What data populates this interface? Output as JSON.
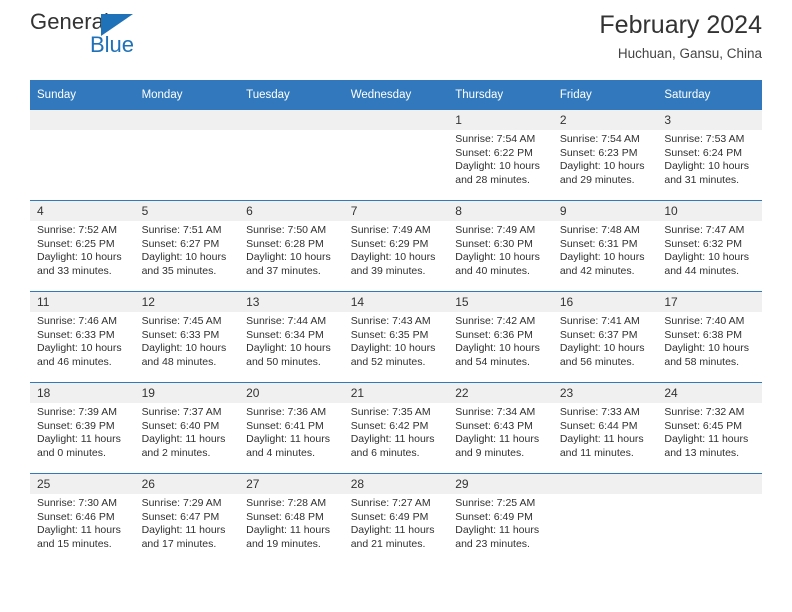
{
  "brand": {
    "word1": "General",
    "word2": "Blue",
    "accent_color": "#1f72b8"
  },
  "header": {
    "title": "February 2024",
    "subtitle": "Huchuan, Gansu, China"
  },
  "theme": {
    "header_bg": "#3179bc",
    "daynum_bg": "#f0f0f0",
    "grid_line": "#3179bc"
  },
  "weekday_headers": [
    "Sunday",
    "Monday",
    "Tuesday",
    "Wednesday",
    "Thursday",
    "Friday",
    "Saturday"
  ],
  "weeks": [
    [
      {
        "day": "",
        "sunrise": "",
        "sunset": "",
        "daylight": ""
      },
      {
        "day": "",
        "sunrise": "",
        "sunset": "",
        "daylight": ""
      },
      {
        "day": "",
        "sunrise": "",
        "sunset": "",
        "daylight": ""
      },
      {
        "day": "",
        "sunrise": "",
        "sunset": "",
        "daylight": ""
      },
      {
        "day": "1",
        "sunrise": "Sunrise: 7:54 AM",
        "sunset": "Sunset: 6:22 PM",
        "daylight": "Daylight: 10 hours and 28 minutes."
      },
      {
        "day": "2",
        "sunrise": "Sunrise: 7:54 AM",
        "sunset": "Sunset: 6:23 PM",
        "daylight": "Daylight: 10 hours and 29 minutes."
      },
      {
        "day": "3",
        "sunrise": "Sunrise: 7:53 AM",
        "sunset": "Sunset: 6:24 PM",
        "daylight": "Daylight: 10 hours and 31 minutes."
      }
    ],
    [
      {
        "day": "4",
        "sunrise": "Sunrise: 7:52 AM",
        "sunset": "Sunset: 6:25 PM",
        "daylight": "Daylight: 10 hours and 33 minutes."
      },
      {
        "day": "5",
        "sunrise": "Sunrise: 7:51 AM",
        "sunset": "Sunset: 6:27 PM",
        "daylight": "Daylight: 10 hours and 35 minutes."
      },
      {
        "day": "6",
        "sunrise": "Sunrise: 7:50 AM",
        "sunset": "Sunset: 6:28 PM",
        "daylight": "Daylight: 10 hours and 37 minutes."
      },
      {
        "day": "7",
        "sunrise": "Sunrise: 7:49 AM",
        "sunset": "Sunset: 6:29 PM",
        "daylight": "Daylight: 10 hours and 39 minutes."
      },
      {
        "day": "8",
        "sunrise": "Sunrise: 7:49 AM",
        "sunset": "Sunset: 6:30 PM",
        "daylight": "Daylight: 10 hours and 40 minutes."
      },
      {
        "day": "9",
        "sunrise": "Sunrise: 7:48 AM",
        "sunset": "Sunset: 6:31 PM",
        "daylight": "Daylight: 10 hours and 42 minutes."
      },
      {
        "day": "10",
        "sunrise": "Sunrise: 7:47 AM",
        "sunset": "Sunset: 6:32 PM",
        "daylight": "Daylight: 10 hours and 44 minutes."
      }
    ],
    [
      {
        "day": "11",
        "sunrise": "Sunrise: 7:46 AM",
        "sunset": "Sunset: 6:33 PM",
        "daylight": "Daylight: 10 hours and 46 minutes."
      },
      {
        "day": "12",
        "sunrise": "Sunrise: 7:45 AM",
        "sunset": "Sunset: 6:33 PM",
        "daylight": "Daylight: 10 hours and 48 minutes."
      },
      {
        "day": "13",
        "sunrise": "Sunrise: 7:44 AM",
        "sunset": "Sunset: 6:34 PM",
        "daylight": "Daylight: 10 hours and 50 minutes."
      },
      {
        "day": "14",
        "sunrise": "Sunrise: 7:43 AM",
        "sunset": "Sunset: 6:35 PM",
        "daylight": "Daylight: 10 hours and 52 minutes."
      },
      {
        "day": "15",
        "sunrise": "Sunrise: 7:42 AM",
        "sunset": "Sunset: 6:36 PM",
        "daylight": "Daylight: 10 hours and 54 minutes."
      },
      {
        "day": "16",
        "sunrise": "Sunrise: 7:41 AM",
        "sunset": "Sunset: 6:37 PM",
        "daylight": "Daylight: 10 hours and 56 minutes."
      },
      {
        "day": "17",
        "sunrise": "Sunrise: 7:40 AM",
        "sunset": "Sunset: 6:38 PM",
        "daylight": "Daylight: 10 hours and 58 minutes."
      }
    ],
    [
      {
        "day": "18",
        "sunrise": "Sunrise: 7:39 AM",
        "sunset": "Sunset: 6:39 PM",
        "daylight": "Daylight: 11 hours and 0 minutes."
      },
      {
        "day": "19",
        "sunrise": "Sunrise: 7:37 AM",
        "sunset": "Sunset: 6:40 PM",
        "daylight": "Daylight: 11 hours and 2 minutes."
      },
      {
        "day": "20",
        "sunrise": "Sunrise: 7:36 AM",
        "sunset": "Sunset: 6:41 PM",
        "daylight": "Daylight: 11 hours and 4 minutes."
      },
      {
        "day": "21",
        "sunrise": "Sunrise: 7:35 AM",
        "sunset": "Sunset: 6:42 PM",
        "daylight": "Daylight: 11 hours and 6 minutes."
      },
      {
        "day": "22",
        "sunrise": "Sunrise: 7:34 AM",
        "sunset": "Sunset: 6:43 PM",
        "daylight": "Daylight: 11 hours and 9 minutes."
      },
      {
        "day": "23",
        "sunrise": "Sunrise: 7:33 AM",
        "sunset": "Sunset: 6:44 PM",
        "daylight": "Daylight: 11 hours and 11 minutes."
      },
      {
        "day": "24",
        "sunrise": "Sunrise: 7:32 AM",
        "sunset": "Sunset: 6:45 PM",
        "daylight": "Daylight: 11 hours and 13 minutes."
      }
    ],
    [
      {
        "day": "25",
        "sunrise": "Sunrise: 7:30 AM",
        "sunset": "Sunset: 6:46 PM",
        "daylight": "Daylight: 11 hours and 15 minutes."
      },
      {
        "day": "26",
        "sunrise": "Sunrise: 7:29 AM",
        "sunset": "Sunset: 6:47 PM",
        "daylight": "Daylight: 11 hours and 17 minutes."
      },
      {
        "day": "27",
        "sunrise": "Sunrise: 7:28 AM",
        "sunset": "Sunset: 6:48 PM",
        "daylight": "Daylight: 11 hours and 19 minutes."
      },
      {
        "day": "28",
        "sunrise": "Sunrise: 7:27 AM",
        "sunset": "Sunset: 6:49 PM",
        "daylight": "Daylight: 11 hours and 21 minutes."
      },
      {
        "day": "29",
        "sunrise": "Sunrise: 7:25 AM",
        "sunset": "Sunset: 6:49 PM",
        "daylight": "Daylight: 11 hours and 23 minutes."
      },
      {
        "day": "",
        "sunrise": "",
        "sunset": "",
        "daylight": ""
      },
      {
        "day": "",
        "sunrise": "",
        "sunset": "",
        "daylight": ""
      }
    ]
  ]
}
